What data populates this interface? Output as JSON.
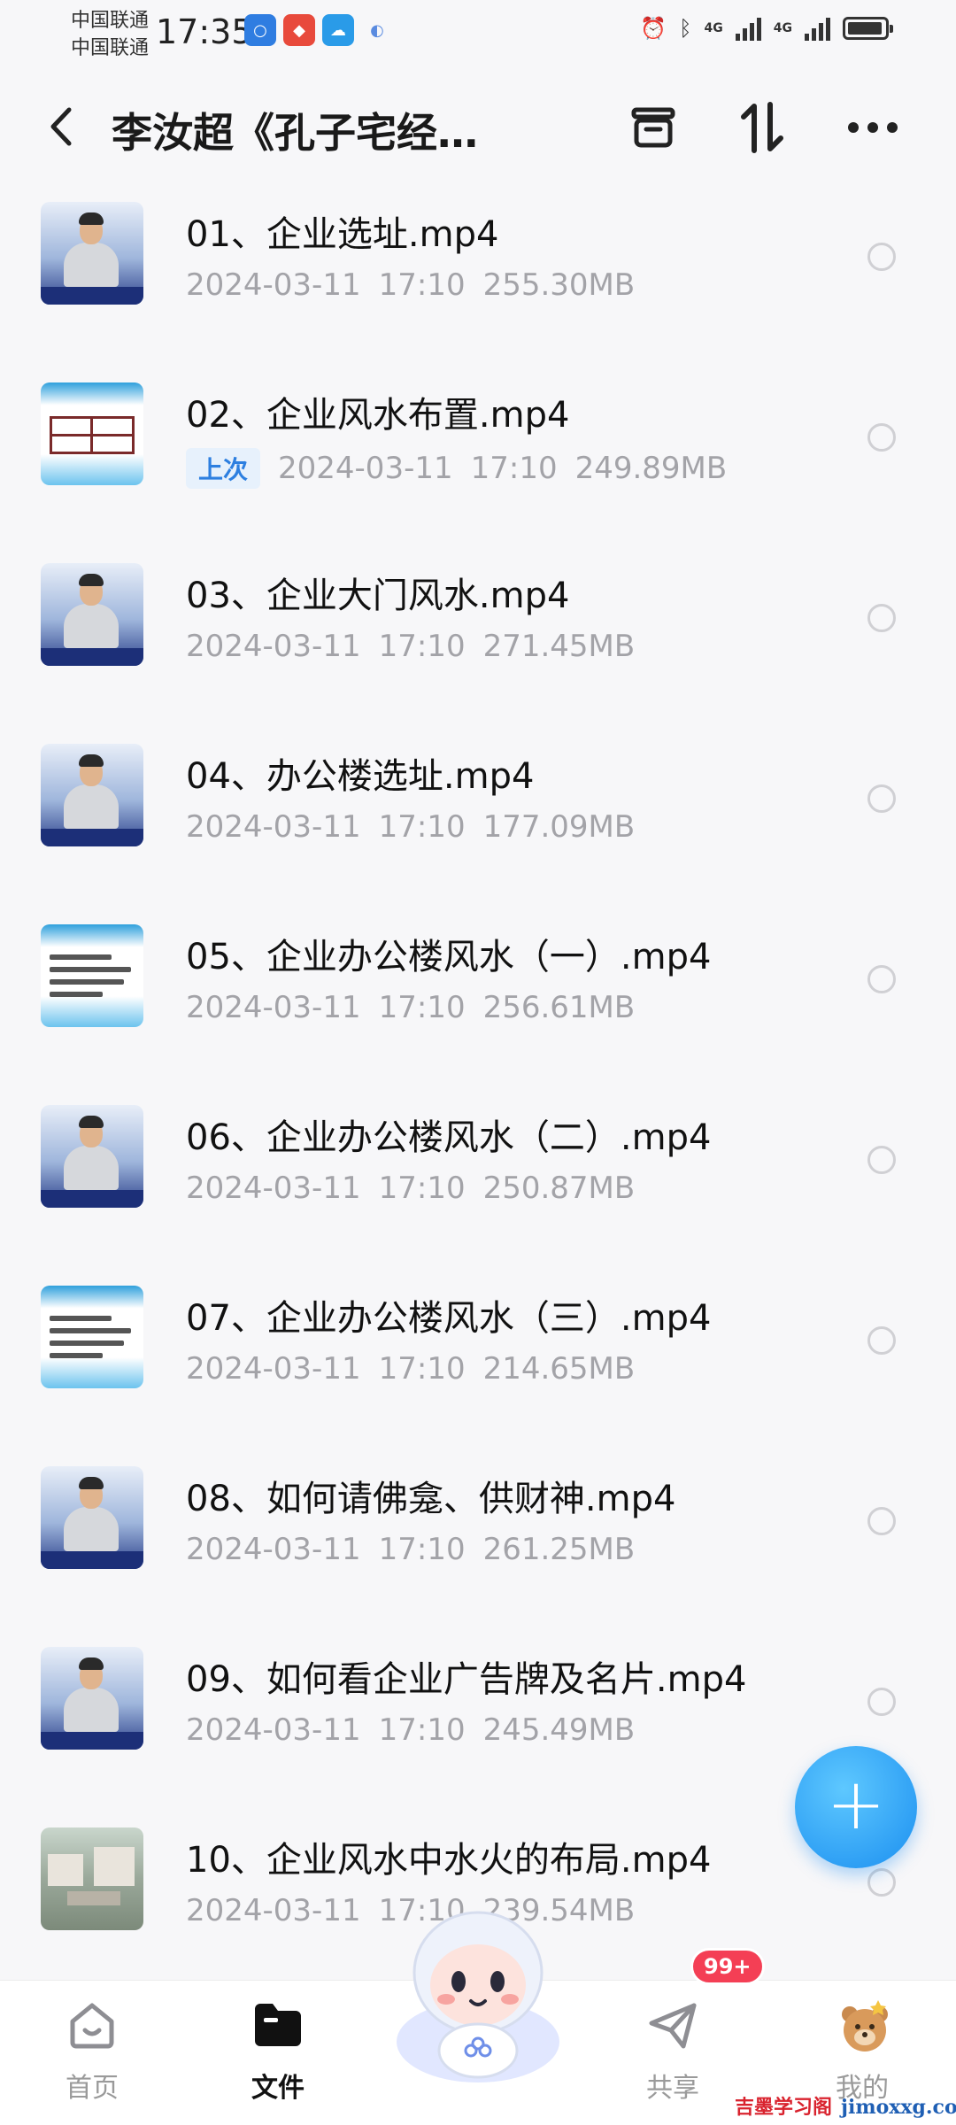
{
  "status_bar": {
    "carrier_1": "中国联通",
    "carrier_2": "中国联通",
    "time": "17:35",
    "network_1": "4G",
    "network_2": "4G"
  },
  "header": {
    "title": "李汝超《孔子宅经…",
    "back_icon": "chevron-left-icon",
    "icons": [
      "archive-icon",
      "sort-icon",
      "more-icon"
    ]
  },
  "files": [
    {
      "name": "01、企业选址.mp4",
      "date": "2024-03-11",
      "time": "17:10",
      "size": "255.30MB",
      "thumb": "person"
    },
    {
      "name": "02、企业风水布置.mp4",
      "badge": "上次",
      "date": "2024-03-11",
      "time": "17:10",
      "size": "249.89MB",
      "thumb": "diagram"
    },
    {
      "name": "03、企业大门风水.mp4",
      "date": "2024-03-11",
      "time": "17:10",
      "size": "271.45MB",
      "thumb": "person"
    },
    {
      "name": "04、办公楼选址.mp4",
      "date": "2024-03-11",
      "time": "17:10",
      "size": "177.09MB",
      "thumb": "person"
    },
    {
      "name": "05、企业办公楼风水（一）.mp4",
      "date": "2024-03-11",
      "time": "17:10",
      "size": "256.61MB",
      "thumb": "slide"
    },
    {
      "name": "06、企业办公楼风水（二）.mp4",
      "date": "2024-03-11",
      "time": "17:10",
      "size": "250.87MB",
      "thumb": "person"
    },
    {
      "name": "07、企业办公楼风水（三）.mp4",
      "date": "2024-03-11",
      "time": "17:10",
      "size": "214.65MB",
      "thumb": "slide"
    },
    {
      "name": "08、如何请佛龛、供财神.mp4",
      "date": "2024-03-11",
      "time": "17:10",
      "size": "261.25MB",
      "thumb": "person"
    },
    {
      "name": "09、如何看企业广告牌及名片.mp4",
      "date": "2024-03-11",
      "time": "17:10",
      "size": "245.49MB",
      "thumb": "person"
    },
    {
      "name": "10、企业风水中水火的布局.mp4",
      "date": "2024-03-11",
      "time": "17:10",
      "size": "239.54MB",
      "thumb": "campus"
    }
  ],
  "fab": {
    "label": "+"
  },
  "bottom_nav": {
    "items": [
      {
        "label": "首页",
        "icon": "home-icon",
        "active": false
      },
      {
        "label": "文件",
        "icon": "folder-icon",
        "active": true
      },
      {
        "label": "共享",
        "icon": "share-icon",
        "active": false
      },
      {
        "label": "我的",
        "icon": "profile-icon",
        "active": false
      }
    ],
    "badge": "99+"
  },
  "watermark": {
    "cn": "吉墨学习阁",
    "en": "jimoxxg.com"
  },
  "colors": {
    "accent": "#1b8ff0",
    "badge": "#f43f55",
    "meta": "#a3a3a8"
  }
}
